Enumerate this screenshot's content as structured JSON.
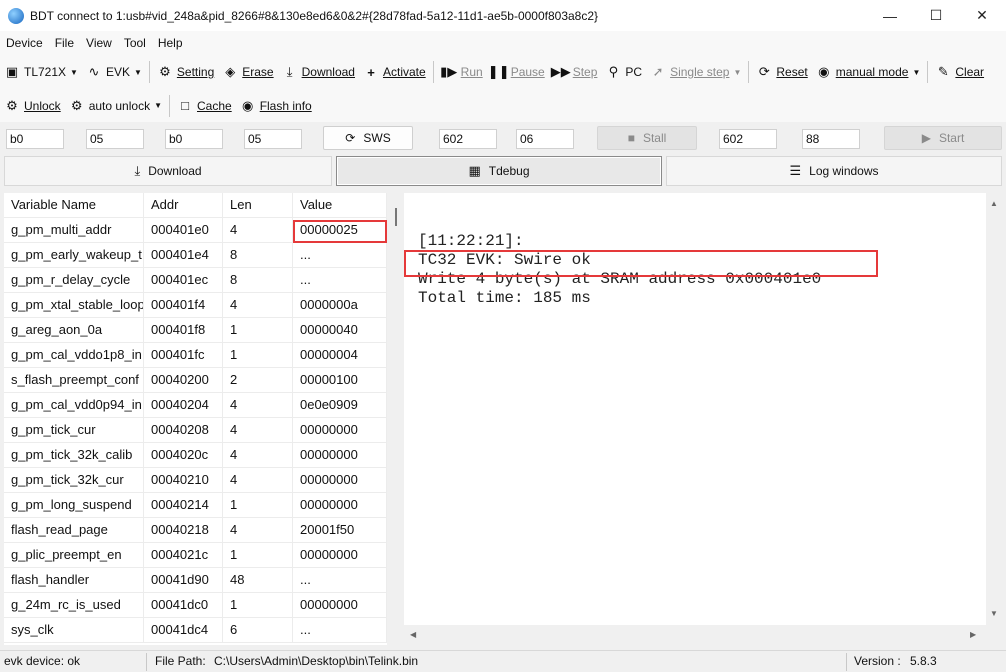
{
  "window": {
    "title": "BDT connect to 1:usb#vid_248a&pid_8266#8&130e8ed6&0&2#{28d78fad-5a12-11d1-ae5b-0000f803a8c2}",
    "app_icon": "globe-icon"
  },
  "menu": [
    "Device",
    "File",
    "View",
    "Tool",
    "Help"
  ],
  "toolbar1": {
    "chip_select": "TL721X",
    "board_select": "EVK",
    "setting": "Setting",
    "erase": "Erase",
    "download": "Download",
    "activate": "Activate",
    "run": "Run",
    "pause": "Pause",
    "step": "Step",
    "pc": "PC",
    "single_step": "Single step",
    "reset": "Reset",
    "mode_select": "manual mode",
    "clear": "Clear"
  },
  "toolbar2": {
    "unlock": "Unlock",
    "auto_unlock": "auto unlock",
    "cache": "Cache",
    "flash_info": "Flash info"
  },
  "params": {
    "f1": "b0",
    "f2": "05",
    "f3": "b0",
    "f4": "05",
    "sws_button": "SWS",
    "f5": "602",
    "f6": "06",
    "stall_button": "Stall",
    "f7": "602",
    "f8": "88",
    "start_button": "Start"
  },
  "tabs": {
    "download": "Download",
    "tdebug": "Tdebug",
    "log_windows": "Log windows"
  },
  "table": {
    "headers": [
      "Variable Name",
      "Addr",
      "Len",
      "Value"
    ],
    "rows": [
      [
        "g_pm_multi_addr",
        "000401e0",
        "4",
        "00000025"
      ],
      [
        "g_pm_early_wakeup_t",
        "000401e4",
        "8",
        "..."
      ],
      [
        "g_pm_r_delay_cycle",
        "000401ec",
        "8",
        "..."
      ],
      [
        "g_pm_xtal_stable_loop",
        "000401f4",
        "4",
        "0000000a"
      ],
      [
        "g_areg_aon_0a",
        "000401f8",
        "1",
        "00000040"
      ],
      [
        "g_pm_cal_vddo1p8_in",
        "000401fc",
        "1",
        "00000004"
      ],
      [
        "s_flash_preempt_conf",
        "00040200",
        "2",
        "00000100"
      ],
      [
        "g_pm_cal_vdd0p94_in",
        "00040204",
        "4",
        "0e0e0909"
      ],
      [
        "g_pm_tick_cur",
        "00040208",
        "4",
        "00000000"
      ],
      [
        "g_pm_tick_32k_calib",
        "0004020c",
        "4",
        "00000000"
      ],
      [
        "g_pm_tick_32k_cur",
        "00040210",
        "4",
        "00000000"
      ],
      [
        "g_pm_long_suspend",
        "00040214",
        "1",
        "00000000"
      ],
      [
        "flash_read_page",
        "00040218",
        "4",
        "20001f50"
      ],
      [
        "g_plic_preempt_en",
        "0004021c",
        "1",
        "00000000"
      ],
      [
        "flash_handler",
        "00041d90",
        "48",
        "..."
      ],
      [
        "g_24m_rc_is_used",
        "00041dc0",
        "1",
        "00000000"
      ],
      [
        "sys_clk",
        "00041dc4",
        "6",
        "..."
      ]
    ]
  },
  "log": {
    "lines": [
      "[11:22:21]:",
      "TC32 EVK: Swire ok",
      "Write 4 byte(s) at SRAM address 0x000401e0",
      "Total time: 185 ms"
    ]
  },
  "status": {
    "device": "evk device: ok",
    "file_path_label": "File Path:",
    "file_path": "C:\\Users\\Admin\\Desktop\\bin\\Telink.bin",
    "version_label": "Version :",
    "version": "5.8.3"
  },
  "colors": {
    "highlight_box": "#e5393a",
    "log_bg": "#ffffff"
  }
}
